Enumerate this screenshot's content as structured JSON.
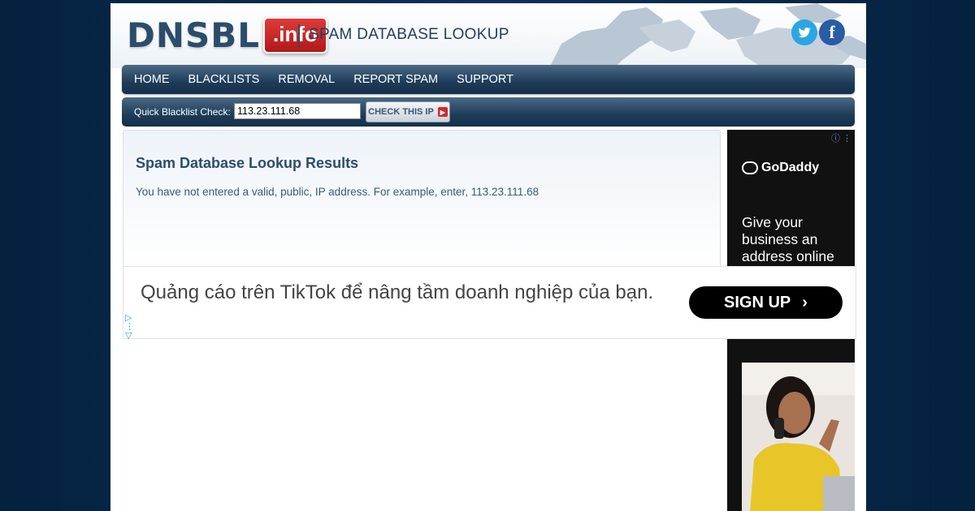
{
  "header": {
    "logo_text": "DNSBL",
    "logo_badge": ".info",
    "tagline": "SPAM DATABASE LOOKUP",
    "social": {
      "twitter_icon": "twitter-icon",
      "facebook_icon": "facebook-icon"
    }
  },
  "nav": {
    "items": [
      {
        "label": "HOME"
      },
      {
        "label": "BLACKLISTS"
      },
      {
        "label": "REMOVAL"
      },
      {
        "label": "REPORT SPAM"
      },
      {
        "label": "SUPPORT"
      }
    ]
  },
  "quick_check": {
    "label": "Quick Blacklist Check:",
    "input_value": "113.23.111.68",
    "button_label": "CHECK THIS IP"
  },
  "results": {
    "title": "Spam Database Lookup Results",
    "message": "You have not entered a valid, public, IP address. For example, enter, 113.23.111.68"
  },
  "side_ad": {
    "brand": "GoDaddy",
    "text": "Give your business an address online"
  },
  "tiktok_ad": {
    "text": "Quảng cáo trên TikTok để nâng tầm doanh nghiệp của bạn.",
    "button_label": "SIGN UP"
  },
  "colors": {
    "page_bg": "#002a4d",
    "nav_bg": "#1e3b58",
    "title_blue": "#2b4d6b",
    "logo_red": "#c62222",
    "twitter": "#2ba6e1",
    "facebook": "#2a5ca5"
  }
}
